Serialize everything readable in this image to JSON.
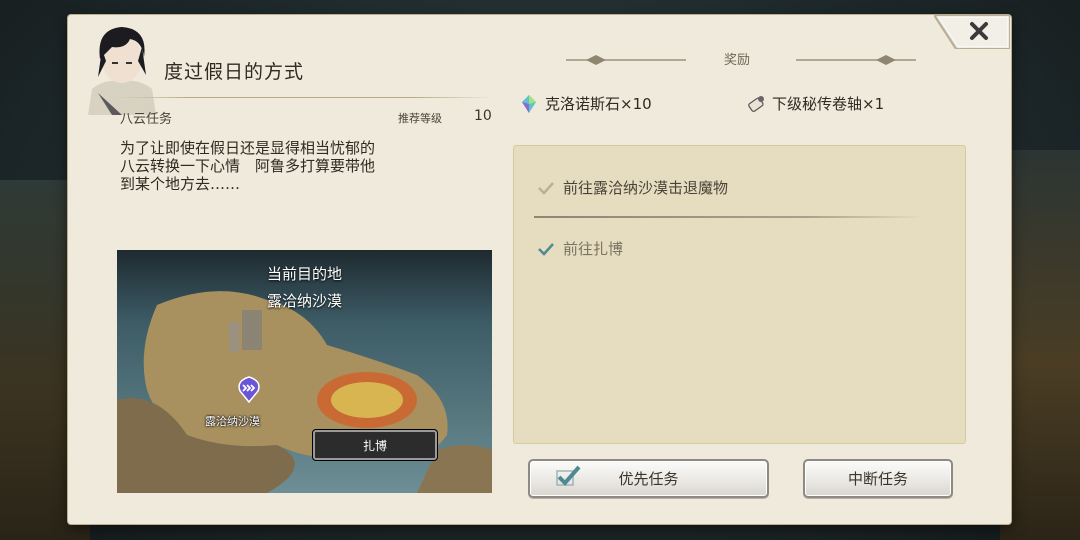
{
  "quest": {
    "title": "度过假日的方式",
    "type": "八云任务",
    "recommended_level_label": "推荐等级",
    "recommended_level": "10",
    "description": "为了让即使在假日还是显得相当忧郁的\n八云转换一下心情　阿鲁多打算要带他\n到某个地方去……"
  },
  "map": {
    "current_destination_label": "当前目的地",
    "current_destination": "露洽纳沙漠",
    "location_label": "露洽纳沙漠",
    "target_button": "扎博"
  },
  "rewards": {
    "header": "奖励",
    "items": [
      {
        "label": "克洛诺斯石×10",
        "icon": "crystal-icon"
      },
      {
        "label": "下级秘传卷轴×1",
        "icon": "scroll-icon"
      }
    ]
  },
  "objectives": [
    {
      "label": "前往露洽纳沙漠击退魔物",
      "done": true
    },
    {
      "label": "前往扎博",
      "done": true
    }
  ],
  "buttons": {
    "priority": "优先任务",
    "abort": "中断任务"
  },
  "colors": {
    "panel_bg": "#efeadb",
    "objective_box": "#e6dcc0",
    "check_teal": "#4f8a93"
  }
}
